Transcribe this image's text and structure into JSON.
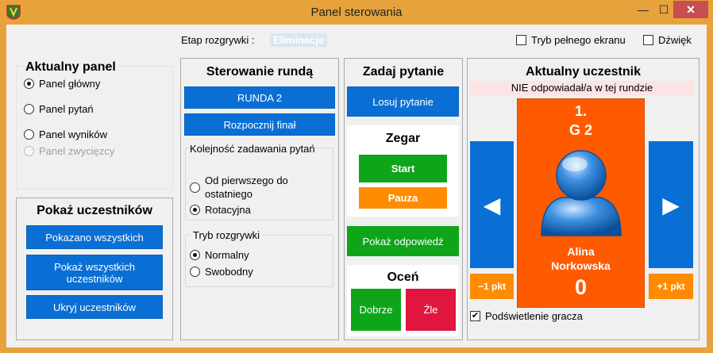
{
  "window": {
    "title": "Panel sterowania",
    "min_icon": "—",
    "max_icon": "☐",
    "close_icon": "✕"
  },
  "top": {
    "stage_label": "Etap rozgrywki :",
    "stage_value": "Eliminacje",
    "fullscreen_label": "Tryb pełnego ekranu",
    "sound_label": "Dźwięk"
  },
  "current_panel": {
    "title": "Aktualny panel",
    "options": [
      {
        "label": "Panel główny",
        "selected": true,
        "enabled": true
      },
      {
        "label": "Panel pytań",
        "selected": false,
        "enabled": true
      },
      {
        "label": "Panel wyników",
        "selected": false,
        "enabled": true
      },
      {
        "label": "Panel zwycięzcy",
        "selected": false,
        "enabled": false
      }
    ]
  },
  "show_participants": {
    "title": "Pokaż uczestników",
    "buttons": [
      "Pokazano wszystkich",
      "Pokaż wszystkich uczestników",
      "Ukryj uczestników"
    ]
  },
  "round_control": {
    "title": "Sterowanie rundą",
    "round_button": "RUNDA 2",
    "final_button": "Rozpocznij finał",
    "order_group": "Kolejność zadawania pytań",
    "order_options": [
      {
        "label": "Od pierwszego do ostatniego",
        "selected": false
      },
      {
        "label": "Rotacyjna",
        "selected": true
      }
    ],
    "mode_group": "Tryb rozgrywki",
    "mode_options": [
      {
        "label": "Normalny",
        "selected": true
      },
      {
        "label": "Swobodny",
        "selected": false
      }
    ]
  },
  "ask": {
    "title": "Zadaj pytanie",
    "draw_button": "Losuj pytanie",
    "clock_title": "Zegar",
    "start_button": "Start",
    "pause_button": "Pauza",
    "show_answer_button": "Pokaż odpowiedź",
    "rate_title": "Oceń",
    "good_button": "Dobrze",
    "bad_button": "Źle"
  },
  "current_participant": {
    "title": "Aktualny uczestnik",
    "status": "NIE odpowiadał/a w tej rundzie",
    "position": "1.",
    "group": "G 2",
    "first_name": "Alina",
    "last_name": "Norkowska",
    "score": "0",
    "prev_icon": "◀",
    "next_icon": "▶",
    "minus_button": "−1 pkt",
    "plus_button": "+1 pkt",
    "highlight_label": "Podświetlenie gracza",
    "highlight_checked": true
  },
  "colors": {
    "blue": "#0a6fd4",
    "green": "#0fa51a",
    "orange": "#ff8c00",
    "participant_bg": "#ff5a00",
    "red": "#e0163f"
  }
}
